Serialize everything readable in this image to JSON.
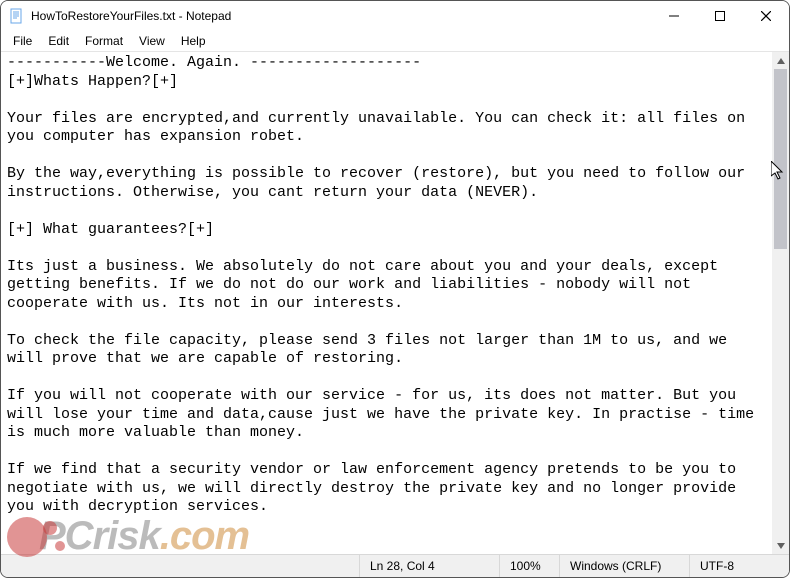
{
  "title": "HowToRestoreYourFiles.txt - Notepad",
  "menu": {
    "file": "File",
    "edit": "Edit",
    "format": "Format",
    "view": "View",
    "help": "Help"
  },
  "document_text": "-----------Welcome. Again. -------------------\n[+]Whats Happen?[+]\n\nYour files are encrypted,and currently unavailable. You can check it: all files on you computer has expansion robet.\n\nBy the way,everything is possible to recover (restore), but you need to follow our instructions. Otherwise, you cant return your data (NEVER).\n\n[+] What guarantees?[+]\n\nIts just a business. We absolutely do not care about you and your deals, except getting benefits. If we do not do our work and liabilities - nobody will not cooperate with us. Its not in our interests.\n\nTo check the file capacity, please send 3 files not larger than 1M to us, and we will prove that we are capable of restoring.\n\nIf you will not cooperate with our service - for us, its does not matter. But you will lose your time and data,cause just we have the private key. In practise - time is much more valuable than money.\n\nIf we find that a security vendor or law enforcement agency pretends to be you to negotiate with us, we will directly destroy the private key and no longer provide you with decryption services.",
  "status": {
    "position": "Ln 28, Col 4",
    "zoom": "100%",
    "line_ending": "Windows (CRLF)",
    "encoding": "UTF-8"
  },
  "watermark": {
    "part1": "PCrisk",
    "part2": ".com"
  },
  "icons": {
    "file": "notepad-file-icon",
    "minimize": "minimize-icon",
    "maximize": "maximize-icon",
    "close": "close-icon",
    "scroll_up": "scroll-up-icon",
    "scroll_down": "scroll-down-icon"
  }
}
